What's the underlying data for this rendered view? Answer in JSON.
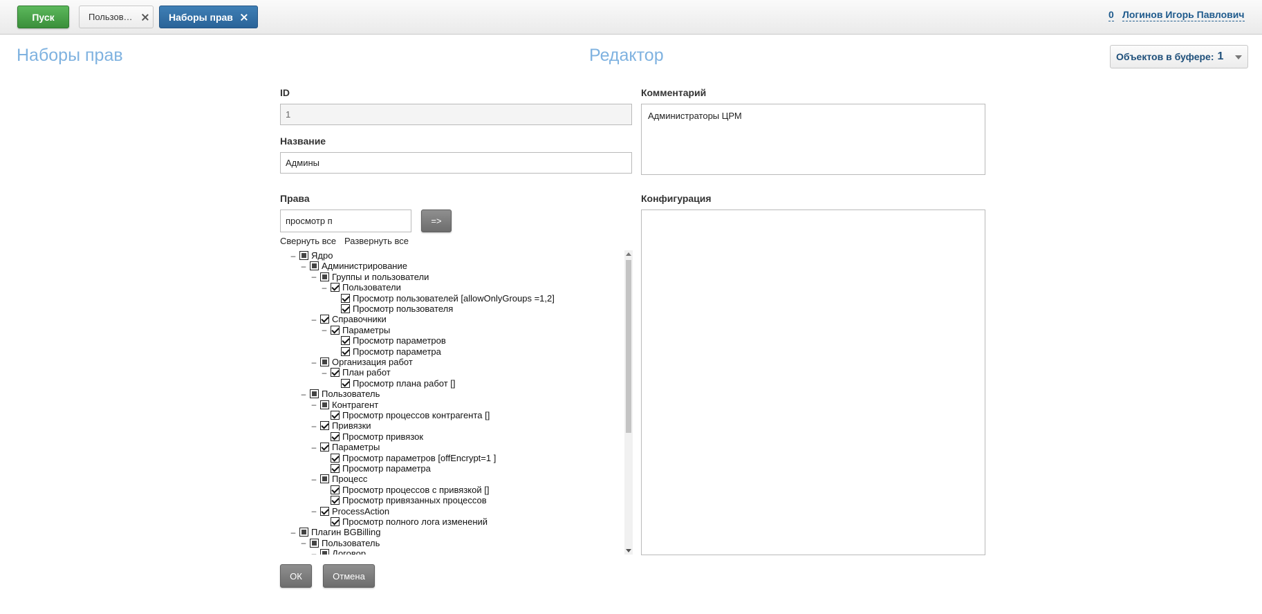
{
  "topbar": {
    "start_label": "Пуск",
    "tabs": [
      {
        "label": "Пользователи",
        "active": false
      },
      {
        "label": "Наборы прав",
        "active": true
      }
    ],
    "user_count": "0",
    "user_name": "Логинов Игорь Павлович"
  },
  "page_title": "Наборы прав",
  "editor_title": "Редактор",
  "buffer": {
    "label": "Объектов в буфере:",
    "count": "1"
  },
  "form": {
    "id_label": "ID",
    "id_value": "1",
    "name_label": "Название",
    "name_value": "Админы",
    "comment_label": "Комментарий",
    "comment_value": "Администраторы ЦРМ",
    "rights_label": "Права",
    "rights_filter_value": "просмотр п",
    "apply_filter_label": "=>",
    "collapse_all": "Свернуть все",
    "expand_all": "Развернуть все",
    "config_label": "Конфигурация",
    "config_value": "",
    "ok_label": "ОК",
    "cancel_label": "Отмена"
  },
  "rights_tree": [
    {
      "level": 0,
      "toggle": "–",
      "state": "partial",
      "label": "Ядро"
    },
    {
      "level": 1,
      "toggle": "–",
      "state": "partial",
      "label": "Администрирование"
    },
    {
      "level": 2,
      "toggle": "–",
      "state": "partial",
      "label": "Группы и пользователи"
    },
    {
      "level": 3,
      "toggle": "–",
      "state": "checked",
      "label": "Пользователи"
    },
    {
      "level": 4,
      "toggle": "",
      "state": "checked",
      "label": "Просмотр пользователей [allowOnlyGroups =1,2]"
    },
    {
      "level": 4,
      "toggle": "",
      "state": "checked",
      "label": "Просмотр пользователя"
    },
    {
      "level": 2,
      "toggle": "–",
      "state": "checked",
      "label": "Справочники"
    },
    {
      "level": 3,
      "toggle": "–",
      "state": "checked",
      "label": "Параметры"
    },
    {
      "level": 4,
      "toggle": "",
      "state": "checked",
      "label": "Просмотр параметров"
    },
    {
      "level": 4,
      "toggle": "",
      "state": "checked",
      "label": "Просмотр параметра"
    },
    {
      "level": 2,
      "toggle": "–",
      "state": "partial",
      "label": "Организация работ"
    },
    {
      "level": 3,
      "toggle": "–",
      "state": "checked",
      "label": "План работ"
    },
    {
      "level": 4,
      "toggle": "",
      "state": "checked",
      "label": "Просмотр плана работ []"
    },
    {
      "level": 1,
      "toggle": "–",
      "state": "partial",
      "label": "Пользователь"
    },
    {
      "level": 2,
      "toggle": "–",
      "state": "partial",
      "label": "Контрагент"
    },
    {
      "level": 3,
      "toggle": "",
      "state": "checked",
      "label": "Просмотр процессов контрагента []"
    },
    {
      "level": 2,
      "toggle": "–",
      "state": "checked",
      "label": "Привязки"
    },
    {
      "level": 3,
      "toggle": "",
      "state": "checked",
      "label": "Просмотр привязок"
    },
    {
      "level": 2,
      "toggle": "–",
      "state": "checked",
      "label": "Параметры"
    },
    {
      "level": 3,
      "toggle": "",
      "state": "checked",
      "label": "Просмотр параметров [offEncrypt=1 ]"
    },
    {
      "level": 3,
      "toggle": "",
      "state": "checked",
      "label": "Просмотр параметра"
    },
    {
      "level": 2,
      "toggle": "–",
      "state": "partial",
      "label": "Процесс"
    },
    {
      "level": 3,
      "toggle": "",
      "state": "checked",
      "label": "Просмотр процессов с привязкой []"
    },
    {
      "level": 3,
      "toggle": "",
      "state": "checked",
      "label": "Просмотр привязанных процессов"
    },
    {
      "level": 2,
      "toggle": "–",
      "state": "checked",
      "label": "ProcessAction"
    },
    {
      "level": 3,
      "toggle": "",
      "state": "checked",
      "label": "Просмотр полного лога изменений"
    },
    {
      "level": 0,
      "toggle": "–",
      "state": "partial",
      "label": "Плагин BGBilling"
    },
    {
      "level": 1,
      "toggle": "–",
      "state": "partial",
      "label": "Пользователь"
    },
    {
      "level": 2,
      "toggle": "–",
      "state": "partial",
      "label": "Договор"
    }
  ]
}
